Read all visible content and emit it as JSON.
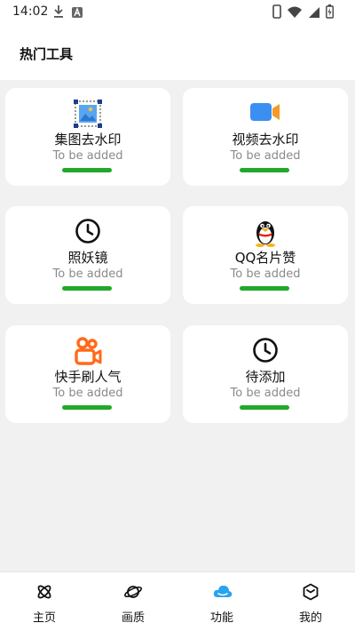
{
  "status_bar": {
    "time": "14:02",
    "icons": [
      "download-icon",
      "notification-a-icon",
      "phone-icon",
      "wifi-icon",
      "signal-icon",
      "battery-icon"
    ]
  },
  "header": {
    "title": "热门工具"
  },
  "cards": [
    {
      "title": "集图去水印",
      "subtitle": "To be added",
      "icon": "image-select-icon"
    },
    {
      "title": "视频去水印",
      "subtitle": "To be added",
      "icon": "video-camera-icon"
    },
    {
      "title": "照妖镜",
      "subtitle": "To be added",
      "icon": "clock-icon"
    },
    {
      "title": "QQ名片赞",
      "subtitle": "To be added",
      "icon": "qq-penguin-icon"
    },
    {
      "title": "快手刷人气",
      "subtitle": "To be added",
      "icon": "kuaishou-icon"
    },
    {
      "title": "待添加",
      "subtitle": "To be added",
      "icon": "clock-icon"
    }
  ],
  "bottom_nav": [
    {
      "label": "主页",
      "icon": "atom-icon"
    },
    {
      "label": "画质",
      "icon": "planet-icon"
    },
    {
      "label": "功能",
      "icon": "cloud-icon",
      "active": true
    },
    {
      "label": "我的",
      "icon": "cube-icon"
    }
  ],
  "colors": {
    "accent_green": "#22a82a",
    "active_blue": "#2aa3ee",
    "kuaishou_orange": "#ff6a1a",
    "video_blue": "#3b8ff0"
  }
}
